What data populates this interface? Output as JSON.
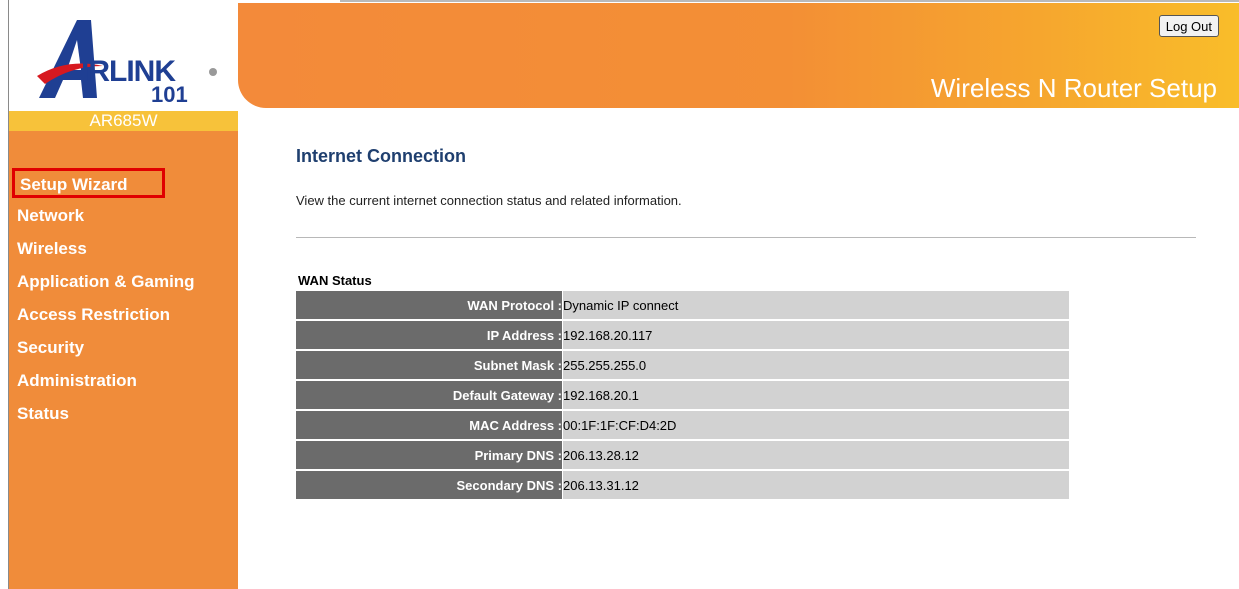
{
  "brand": {
    "logo_text": "IRLINK",
    "logo_number": "101",
    "model": "AR685W"
  },
  "header": {
    "logout_label": "Log Out",
    "title": "Wireless N Router Setup"
  },
  "sidebar": {
    "items": [
      {
        "label": "Setup Wizard",
        "selected": true
      },
      {
        "label": "Network"
      },
      {
        "label": "Wireless"
      },
      {
        "label": "Application & Gaming"
      },
      {
        "label": "Access Restriction"
      },
      {
        "label": "Security"
      },
      {
        "label": "Administration"
      },
      {
        "label": "Status"
      }
    ]
  },
  "main": {
    "title": "Internet Connection",
    "description": "View the current internet connection status and related information.",
    "section_title": "WAN Status",
    "rows": [
      {
        "label": "WAN Protocol :",
        "value": "Dynamic IP connect"
      },
      {
        "label": "IP Address :",
        "value": "192.168.20.117"
      },
      {
        "label": "Subnet Mask :",
        "value": "255.255.255.0"
      },
      {
        "label": "Default Gateway :",
        "value": "192.168.20.1"
      },
      {
        "label": "MAC Address :",
        "value": "00:1F:1F:CF:D4:2D"
      },
      {
        "label": "Primary DNS :",
        "value": "206.13.28.12"
      },
      {
        "label": "Secondary DNS :",
        "value": "206.13.31.12"
      }
    ]
  },
  "colors": {
    "sidebar_orange": "#f08c3a",
    "model_bar_yellow": "#f7c23a",
    "logo_blue": "#1f3f93",
    "logo_red": "#d71920",
    "title_blue": "#1f3f6f",
    "table_label_bg": "#6b6b6b",
    "table_value_bg": "#d2d2d2",
    "highlight_red": "#e00000"
  }
}
